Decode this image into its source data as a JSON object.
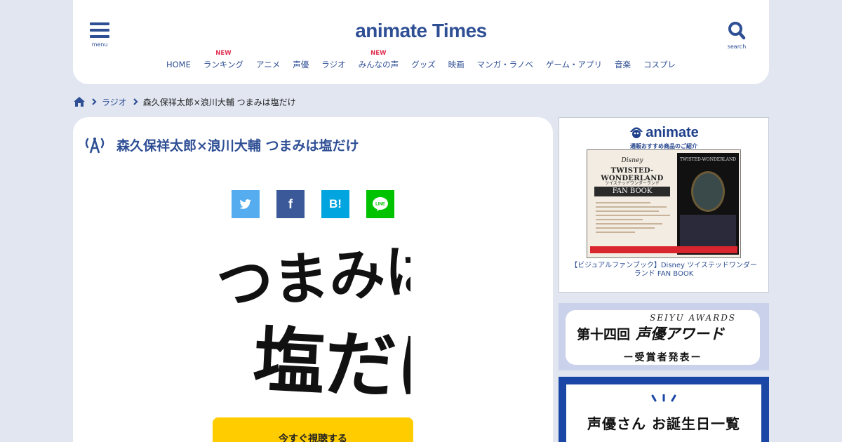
{
  "header": {
    "menu_label": "menu",
    "logo_text": "animate Times",
    "search_label": "search",
    "nav": [
      {
        "label": "HOME",
        "badge": ""
      },
      {
        "label": "ランキング",
        "badge": "NEW"
      },
      {
        "label": "アニメ",
        "badge": ""
      },
      {
        "label": "声優",
        "badge": ""
      },
      {
        "label": "ラジオ",
        "badge": ""
      },
      {
        "label": "みんなの声",
        "badge": "NEW"
      },
      {
        "label": "グッズ",
        "badge": ""
      },
      {
        "label": "映画",
        "badge": ""
      },
      {
        "label": "マンガ・ラノベ",
        "badge": ""
      },
      {
        "label": "ゲーム・アプリ",
        "badge": ""
      },
      {
        "label": "音楽",
        "badge": ""
      },
      {
        "label": "コスプレ",
        "badge": ""
      }
    ]
  },
  "breadcrumb": {
    "home_icon": "home-icon",
    "category": "ラジオ",
    "current": "森久保祥太郎×浪川大輔 つまみは塩だけ"
  },
  "article": {
    "title": "森久保祥太郎×浪川大輔 つまみは塩だけ",
    "title_icon": "radio-broadcast-icon",
    "share_buttons": [
      {
        "name": "twitter",
        "icon": "twitter-bird-icon",
        "color": "#55acee"
      },
      {
        "name": "facebook",
        "label": "f",
        "color": "#3b5998"
      },
      {
        "name": "hatena",
        "label": "B!",
        "color": "#00a4de"
      },
      {
        "name": "line",
        "label": "LINE",
        "color": "#00c300"
      }
    ],
    "program_logo_text": "つまみは塩だけ",
    "listen_button": "今すぐ視聴する"
  },
  "sidebar": {
    "ad1": {
      "brand": "animate",
      "brand_sub": "通販おすすめ商品のご紹介",
      "book_disney": "Disney",
      "book_title": "TWISTED-WONDERLAND",
      "book_kana": "ツイステッドワンダーランド",
      "book_sub": "FAN BOOK",
      "caption": "【ビジュアルファンブック】Disney ツイステッドワンダーランド FAN BOOK"
    },
    "ad2": {
      "ordinal": "第十四回",
      "english": "SEIYU AWARDS",
      "title": "声優アワード",
      "sub": "ー受賞者発表ー"
    },
    "ad3": {
      "text": "声優さん お誕生日一覧"
    }
  },
  "colors": {
    "background": "#e1e6f1",
    "brand_blue": "#2f4f95",
    "new_badge": "#e0314f",
    "listen_button": "#ffcc00"
  }
}
